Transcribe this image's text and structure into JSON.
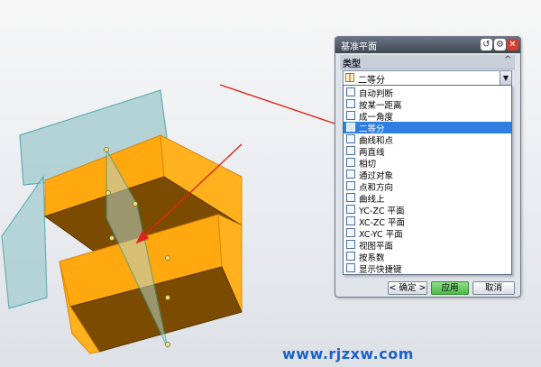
{
  "dialog": {
    "title": "基准平面",
    "section_title": "类型",
    "section_toggle": "^",
    "selected_type": "二等分",
    "dropdown_arrow": "▼",
    "reset_icon": "↺",
    "settings_icon": "⚙",
    "close_icon": "✕",
    "types": [
      {
        "label": "自动判断",
        "icon": "auto-infer-icon"
      },
      {
        "label": "按某一距离",
        "icon": "distance-icon"
      },
      {
        "label": "成一角度",
        "icon": "angle-icon"
      },
      {
        "label": "二等分",
        "icon": "bisector-icon",
        "selected": true
      },
      {
        "label": "曲线和点",
        "icon": "curve-point-icon"
      },
      {
        "label": "两直线",
        "icon": "two-lines-icon"
      },
      {
        "label": "相切",
        "icon": "tangent-icon"
      },
      {
        "label": "通过对象",
        "icon": "through-object-icon"
      },
      {
        "label": "点和方向",
        "icon": "point-direction-icon"
      },
      {
        "label": "曲线上",
        "icon": "on-curve-icon"
      },
      {
        "label": "YC-ZC 平面",
        "icon": "yc-zc-plane-icon"
      },
      {
        "label": "XC-ZC 平面",
        "icon": "xc-zc-plane-icon"
      },
      {
        "label": "XC-YC 平面",
        "icon": "xc-yc-plane-icon"
      },
      {
        "label": "视图平面",
        "icon": "view-plane-icon"
      },
      {
        "label": "按系数",
        "icon": "coefficients-icon"
      },
      {
        "label": "显示快捷键",
        "icon": "shortcut-icon"
      }
    ],
    "ok_label": "< 确定 >",
    "apply_label": "应用",
    "cancel_label": "取消"
  },
  "watermark": "www.rjzxw.com",
  "colors": {
    "face_orange": "#ffa810",
    "face_dark": "#7a4b00",
    "plane_teal": "#9fc8cc",
    "arrow_red": "#e0241c",
    "selection_blue": "#2f7fe0",
    "watermark_blue": "#1c62c9"
  }
}
